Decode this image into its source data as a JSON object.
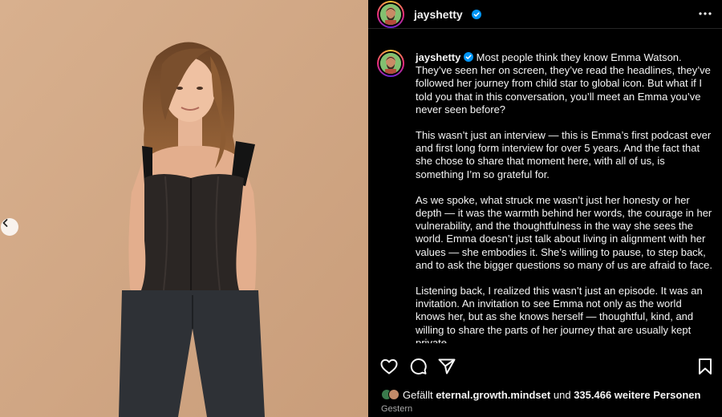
{
  "post": {
    "username": "jayshetty",
    "caption_paragraphs": [
      "Most people think they know Emma Watson. They’ve seen her on screen, they’ve read the headlines, they’ve followed her journey from child star to global icon. But what if I told you that in this conversation, you’ll meet an Emma you’ve never seen before?",
      "This wasn’t just an interview — this is Emma’s first podcast ever and first long form interview for over 5 years. And the fact that she chose to share that moment here, with all of us, is something I’m so grateful for.",
      "As we spoke, what struck me wasn’t just her honesty or her depth — it was the warmth behind her words, the courage in her vulnerability, and the thoughtfulness in the way she sees the world. Emma doesn’t just talk about living in alignment with her values — she embodies it. She’s willing to pause, to step back, and to ask the bigger questions so many of us are afraid to face.",
      "Listening back, I realized this wasn’t just an episode. It was an invitation. An invitation to see Emma not only as the world knows her, but as she knows herself — thoughtful, kind, and willing to share the parts of her journey that are usually kept private."
    ],
    "likes": {
      "prefix": "Gefällt",
      "user": "eternal.growth.mindset",
      "middle": "und",
      "count": "335.466 weitere Personen"
    },
    "date": "Gestern"
  },
  "icons": {
    "verified": "verified-badge-icon",
    "more": "more-options-icon",
    "like": "heart-icon",
    "comment": "comment-icon",
    "share": "send-icon",
    "save": "bookmark-icon",
    "prev": "chevron-left-icon"
  },
  "colors": {
    "background": "#000000",
    "text": "#f5f5f5",
    "muted": "#a8a8a8",
    "verified": "#0095f6",
    "photo_backdrop": "#d2a886"
  }
}
